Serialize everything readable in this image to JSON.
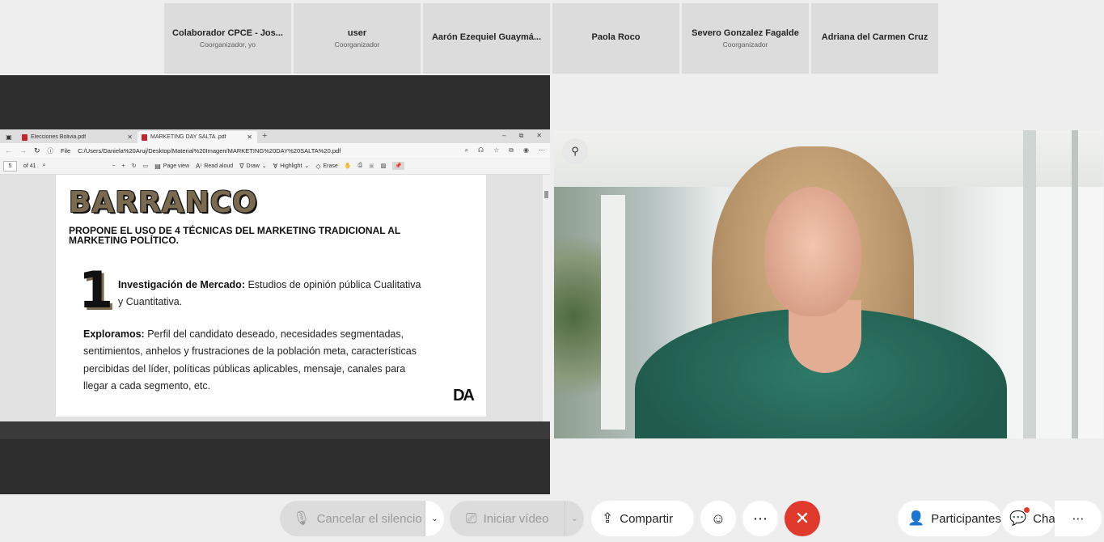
{
  "participants": [
    {
      "name": "Colaborador CPCE - Jos...",
      "role": "Coorganizador, yo"
    },
    {
      "name": "user",
      "role": "Coorganizador"
    },
    {
      "name": "Aarón Ezequiel Guaymá...",
      "role": ""
    },
    {
      "name": "Paola Roco",
      "role": ""
    },
    {
      "name": "Severo Gonzalez Fagalde",
      "role": "Coorganizador"
    },
    {
      "name": "Adriana del Carmen Cruz",
      "role": ""
    }
  ],
  "browser": {
    "tabs": [
      {
        "label": "Elecciones Bolivia.pdf"
      },
      {
        "label": "MARKETING DAY SALTA .pdf"
      }
    ],
    "file_label": "File",
    "url": "C:/Users/Daniela%20Aruj/Desktop/Material%20Imagen/MARKETING%20DAY%20SALTA%20.pdf",
    "page_number": "5",
    "page_count": "of 41",
    "page_view_label": "Page view",
    "read_aloud_label": "Read aloud",
    "draw_label": "Draw",
    "highlight_label": "Highlight",
    "erase_label": "Erase"
  },
  "slide": {
    "brand": "BARRANCO",
    "subtitle": "PROPONE EL USO DE 4 TÉCNICAS DEL MARKETING TRADICIONAL AL MARKETING POLÍTICO.",
    "number": "1",
    "point_title": "Investigación de Mercado:",
    "point_text": " Estudios de opinión pública Cualitativa y Cuantitativa.",
    "explore_title": "Exploramos:",
    "explore_text": " Perfil del candidato deseado, necesidades segmentadas, sentimientos, anhelos y frustraciones de la población meta, características percibidas del líder, políticas públicas aplicables, mensaje, canales para llegar a cada segmento, etc.",
    "logo": "DA"
  },
  "controls": {
    "unmute_label": "Cancelar el silencio",
    "video_label": "Iniciar vídeo",
    "share_label": "Compartir",
    "participants_label": "Participantes",
    "chat_label": "Chat"
  },
  "colors": {
    "leave_red": "#e03a2c",
    "tile_bg": "#dcdcdc",
    "brand_gold": "#7a6a4f"
  }
}
